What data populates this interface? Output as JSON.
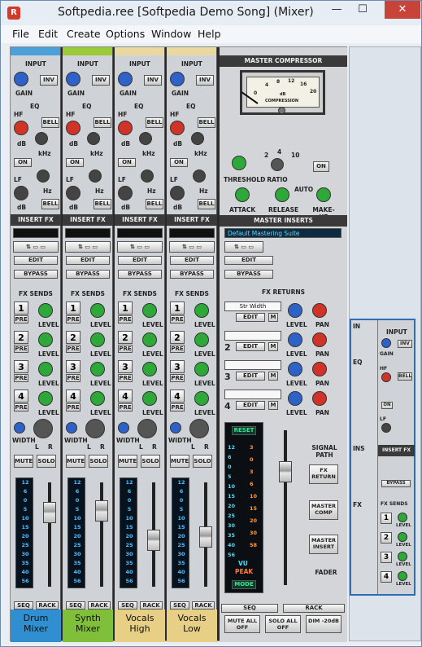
{
  "window": {
    "title": "Softpedia.ree [Softpedia Demo Song] (Mixer)",
    "minimize": "—",
    "maximize": "☐",
    "close": "✕"
  },
  "menu": [
    "File",
    "Edit",
    "Create",
    "Options",
    "Window",
    "Help"
  ],
  "labels": {
    "input": "INPUT",
    "inv": "INV",
    "gain": "GAIN",
    "eq": "EQ",
    "hf": "HF",
    "bell": "BELL",
    "db": "dB",
    "khz": "kHz",
    "on": "ON",
    "lf": "LF",
    "hz": "Hz",
    "insert_fx": "INSERT FX",
    "edit": "EDIT",
    "bypass": "BYPASS",
    "fx_sends": "FX SENDS",
    "pre": "PRE",
    "level": "LEVEL",
    "width": "WIDTH",
    "l": "L",
    "r": "R",
    "mute": "MUTE",
    "solo": "SOLO",
    "seq": "SEQ",
    "rack": "RACK"
  },
  "channels": [
    {
      "name1": "Drum",
      "name2": "Mixer",
      "color": "#4aa0d8",
      "namebg": "#2f8fd0"
    },
    {
      "name1": "Synth",
      "name2": "Mixer",
      "color": "#9ccb3a",
      "namebg": "#7fbf3a"
    },
    {
      "name1": "Vocals",
      "name2": "High",
      "color": "#e9d9a0",
      "namebg": "#e8cf86"
    },
    {
      "name1": "Vocals",
      "name2": "Low",
      "color": "#e9d9a0",
      "namebg": "#e8cf86"
    }
  ],
  "meter_scale": [
    "12",
    "6",
    "0",
    "5",
    "10",
    "15",
    "20",
    "25",
    "30",
    "35",
    "40",
    "56"
  ],
  "sends": [
    "1",
    "2",
    "3",
    "4"
  ],
  "master": {
    "compressor_title": "MASTER COMPRESSOR",
    "vu_scale": [
      "0",
      "4",
      "8",
      "12",
      "16",
      "20"
    ],
    "vu_db": "dB",
    "vu_caption": "COMPRESSION",
    "threshold": "THRESHOLD",
    "ratio": "RATIO",
    "ratio_marks": [
      "2",
      "4",
      "10"
    ],
    "on": "ON",
    "attack": "ATTACK",
    "release": "RELEASE",
    "auto": "AUTO",
    "makeup": "MAKE-UP",
    "inserts_title": "MASTER INSERTS",
    "patch": "Default Mastering Suite",
    "edit": "EDIT",
    "bypass": "BYPASS",
    "fx_returns": "FX RETURNS",
    "return1": "Str Width",
    "edit_btn": "EDIT",
    "m": "M",
    "level": "LEVEL",
    "pan": "PAN",
    "reset": "RESET",
    "scale_left": [
      "12",
      "6",
      "0",
      "5",
      "10",
      "15",
      "20",
      "25",
      "30",
      "35",
      "40",
      "56"
    ],
    "scale_right": [
      "3",
      "0",
      "3",
      "6",
      "10",
      "15",
      "20",
      "30",
      "58"
    ],
    "vu": "VU",
    "peak": "PEAK",
    "mode": "MODE",
    "signal_path": "SIGNAL PATH",
    "fx_return": "FX RETURN",
    "master_comp": "MASTER COMP",
    "master_insert": "MASTER INSERT",
    "fader": "FADER",
    "seq": "SEQ",
    "rack": "RACK",
    "mute_all_off": "MUTE ALL OFF",
    "solo_all_off": "SOLO ALL OFF",
    "dim": "DIM -20dB"
  },
  "side": {
    "in": "IN",
    "eq": "EQ",
    "ins": "INS",
    "fx": "FX",
    "input": "INPUT",
    "inv": "INV",
    "gain": "GAIN",
    "hf": "HF",
    "bell": "BELL",
    "lf": "LF",
    "on": "ON",
    "insert_fx": "INSERT FX",
    "bypass": "BYPASS",
    "fx_sends": "FX SENDS",
    "level": "LEVEL"
  },
  "colors": {
    "accent": "#2e6fb4",
    "knob_blue": "#2f62c8",
    "knob_red": "#d03428",
    "knob_green": "#2fa83a",
    "display_cyan": "#5fd6ff"
  }
}
